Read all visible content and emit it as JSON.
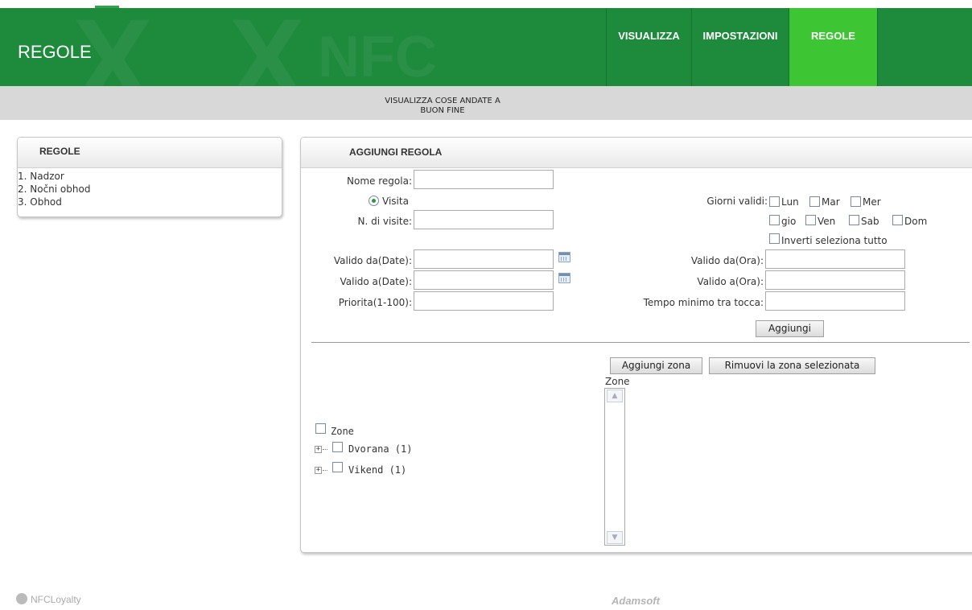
{
  "header": {
    "title": "REGOLE",
    "watermark": "NFC",
    "nav": [
      {
        "label": "VISUALIZZA",
        "active": false
      },
      {
        "label": "IMPOSTAZIONI",
        "active": false
      },
      {
        "label": "REGOLE",
        "active": true
      }
    ],
    "colors": {
      "header_bg": "#1d8a3c",
      "active_tab": "#3dc534"
    }
  },
  "subbar": {
    "line1": "VISUALIZZA COSE ANDATE A",
    "line2": "BUON FINE"
  },
  "rules_panel": {
    "title": "REGOLE",
    "items": [
      "1. Nadzor",
      "2. Nočni obhod",
      "3. Obhod"
    ]
  },
  "add_rule_panel": {
    "title": "AGGIUNGI REGOLA",
    "fields": {
      "name_label": "Nome regola:",
      "name_value": "",
      "visit_option": "Visita",
      "visits_label": "N. di visite:",
      "visits_value": "",
      "valid_from_date_label": "Valido da(Date):",
      "valid_from_date_value": "",
      "valid_to_date_label": "Valido a(Date):",
      "valid_to_date_value": "",
      "priority_label": "Priorita(1-100):",
      "priority_value": "",
      "valid_days_label": "Giorni validi:",
      "days": [
        "Lun",
        "Mar",
        "Mer",
        "gio",
        "Ven",
        "Sab",
        "Dom"
      ],
      "invert_label": "Inverti seleziona tutto",
      "valid_from_time_label": "Valido da(Ora):",
      "valid_from_time_value": "",
      "valid_to_time_label": "Valido a(Ora):",
      "valid_to_time_value": "",
      "min_time_label": "Tempo minimo tra tocca:",
      "min_time_value": ""
    },
    "add_button": "Aggiungi",
    "zones": {
      "add_zone_button": "Aggiungi zona",
      "remove_zone_button": "Rimuovi la zona selezionata",
      "list_label": "Zone",
      "tree_root": "Zone",
      "tree_items": [
        "Dvorana (1)",
        "Vikend (1)"
      ]
    }
  },
  "footer": {
    "logo_text": "NFCLoyalty",
    "brand": "Adamsoft"
  }
}
